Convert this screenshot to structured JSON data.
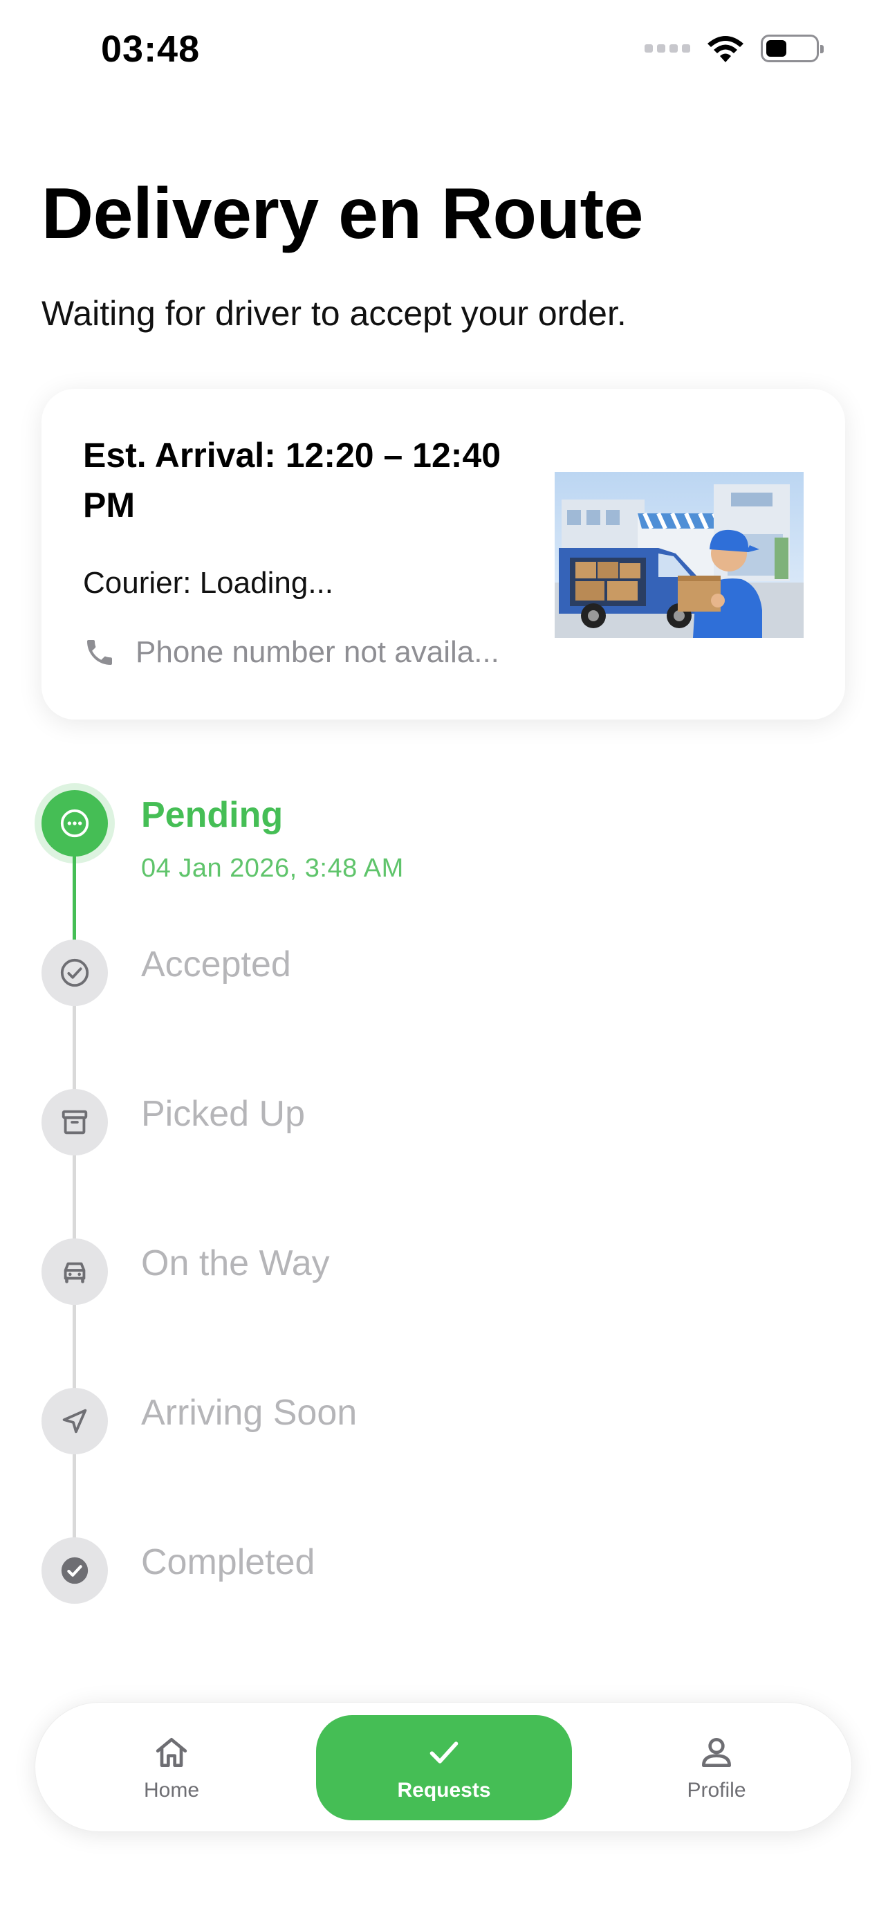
{
  "status_bar": {
    "time": "03:48"
  },
  "header": {
    "title": "Delivery en Route",
    "subtitle": "Waiting for driver to accept your order."
  },
  "card": {
    "eta": "Est. Arrival: 12:20 – 12:40 PM",
    "courier": "Courier: Loading...",
    "phone": "Phone number not availa..."
  },
  "timeline": {
    "steps": [
      {
        "label": "Pending",
        "time": "04 Jan 2026, 3:48 AM",
        "icon": "more-circle-icon"
      },
      {
        "label": "Accepted",
        "icon": "check-circle-outline-icon"
      },
      {
        "label": "Picked Up",
        "icon": "archive-box-icon"
      },
      {
        "label": "On the Way",
        "icon": "car-icon"
      },
      {
        "label": "Arriving Soon",
        "icon": "navigation-arrow-icon"
      },
      {
        "label": "Completed",
        "icon": "check-circle-filled-icon"
      }
    ]
  },
  "bottom_nav": {
    "items": [
      {
        "label": "Home",
        "icon": "home-icon"
      },
      {
        "label": "Requests",
        "icon": "check-icon"
      },
      {
        "label": "Profile",
        "icon": "person-icon"
      }
    ]
  },
  "colors": {
    "accent": "#45BE55",
    "inactive": "#B5B5B8",
    "muted": "#8E8E93"
  }
}
